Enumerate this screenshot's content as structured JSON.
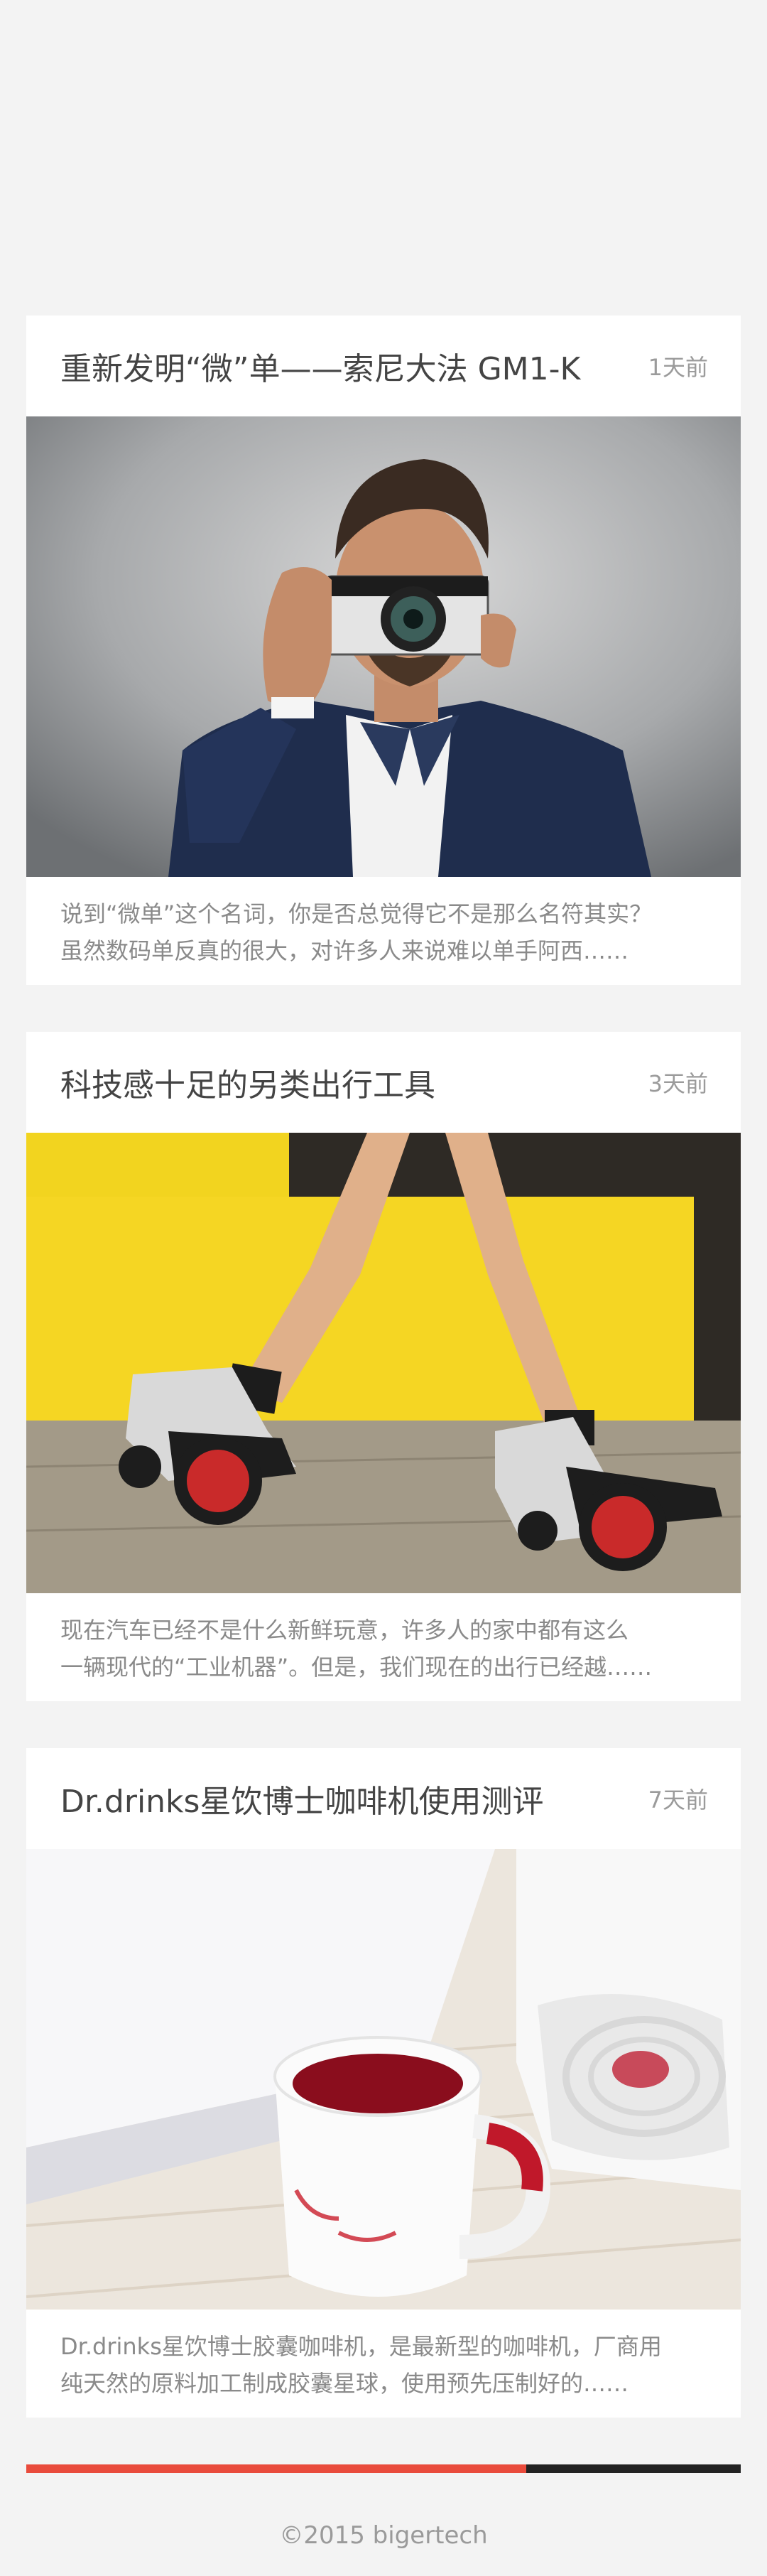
{
  "articles": [
    {
      "title": "重新发明“微”单——索尼大法 GM1-K",
      "time": "1天前",
      "desc_line1": "说到“微单”这个名词，你是否总觉得它不是那么名符其实？",
      "desc_line2": "虽然数码单反真的很大，对许多人来说难以单手阿西……",
      "image_icon": "camera-photo"
    },
    {
      "title": "科技感十足的另类出行工具",
      "time": "3天前",
      "desc_line1": "现在汽车已经不是什么新鲜玩意，许多人的家中都有这么",
      "desc_line2": "一辆现代的“工业机器”。但是，我们现在的出行已经越……",
      "image_icon": "roller-skates-photo"
    },
    {
      "title": "Dr.drinks星饮博士咖啡机使用测评",
      "time": "7天前",
      "desc_line1": "Dr.drinks星饮博士胶囊咖啡机，是最新型的咖啡机，厂商用",
      "desc_line2": "纯天然的原料加工制成胶囊星球，使用预先压制好的……",
      "image_icon": "coffee-machine-photo"
    }
  ],
  "progress": {
    "fraction": 0.7,
    "fill_color": "#e94b3c",
    "track_color": "#222222"
  },
  "footer": {
    "copyright": "©2015 bigertech"
  }
}
